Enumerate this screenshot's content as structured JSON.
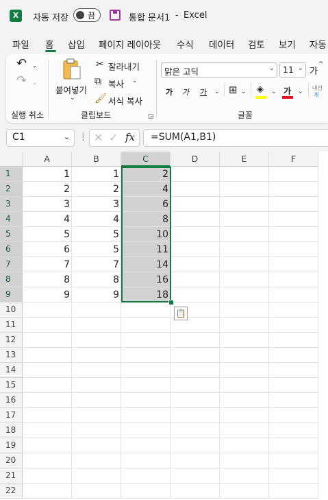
{
  "titlebar": {
    "autosave_label": "자동 저장",
    "toggle_state": "끔",
    "doc_title": "통합 문서1",
    "separator": "-",
    "app_name": "Excel"
  },
  "menu": {
    "items": [
      "파일",
      "홈",
      "삽입",
      "페이지 레이아웃",
      "수식",
      "데이터",
      "검토",
      "보기",
      "자동"
    ],
    "active": "홈"
  },
  "ribbon": {
    "undo_group_label": "실행 취소",
    "clipboard": {
      "label": "클립보드",
      "paste": "붙여넣기",
      "cut": "잘라내기",
      "copy": "복사",
      "format_painter": "서식 복사"
    },
    "font": {
      "label": "글꼴",
      "font_name": "맑은 고딕",
      "font_size": "11",
      "grow": "가",
      "bold": "가",
      "italic": "가",
      "underline": "가",
      "font_color_glyph": "가",
      "highlight_color": "#ffff00",
      "font_color": "#e81123",
      "cut_off_text": "내선",
      "cut_off_text2": "개"
    }
  },
  "formula_bar": {
    "name_box": "C1",
    "fx": "fx",
    "formula": "=SUM(A1,B1)"
  },
  "grid": {
    "columns": [
      "A",
      "B",
      "C",
      "D",
      "E",
      "F"
    ],
    "selected_column": "C",
    "rows": [
      "1",
      "2",
      "3",
      "4",
      "5",
      "6",
      "7",
      "8",
      "9",
      "10",
      "11",
      "12",
      "13",
      "14",
      "15",
      "16",
      "17",
      "18",
      "19",
      "20",
      "21",
      "22"
    ],
    "selected_rows": [
      "1",
      "2",
      "3",
      "4",
      "5",
      "6",
      "7",
      "8",
      "9"
    ],
    "data": [
      [
        "1",
        "1",
        "2"
      ],
      [
        "2",
        "2",
        "4"
      ],
      [
        "3",
        "3",
        "6"
      ],
      [
        "4",
        "4",
        "8"
      ],
      [
        "5",
        "5",
        "10"
      ],
      [
        "6",
        "5",
        "11"
      ],
      [
        "7",
        "7",
        "14"
      ],
      [
        "8",
        "8",
        "16"
      ],
      [
        "9",
        "9",
        "18"
      ]
    ],
    "accent_color": "#107c41"
  }
}
